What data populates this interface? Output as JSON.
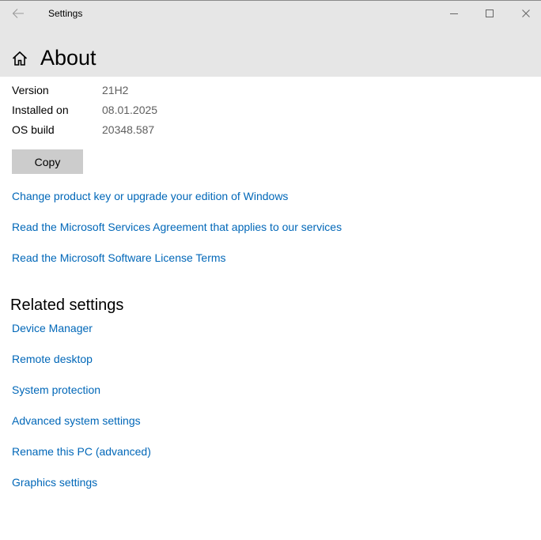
{
  "window": {
    "app_title": "Settings"
  },
  "header": {
    "page_title": "About"
  },
  "specs": [
    {
      "label": "Version",
      "value": "21H2"
    },
    {
      "label": "Installed on",
      "value": "08.01.2025"
    },
    {
      "label": "OS build",
      "value": "20348.587"
    }
  ],
  "copy_button": {
    "label": "Copy"
  },
  "links": [
    "Change product key or upgrade your edition of Windows",
    "Read the Microsoft Services Agreement that applies to our services",
    "Read the Microsoft Software License Terms"
  ],
  "related": {
    "title": "Related settings",
    "items": [
      "Device Manager",
      "Remote desktop",
      "System protection",
      "Advanced system settings",
      "Rename this PC (advanced)",
      "Graphics settings"
    ]
  },
  "colors": {
    "link": "#0067b8",
    "titlebar": "#e6e6e6",
    "button": "#cccccc",
    "secondary_text": "#5f5f5f"
  },
  "icons": {
    "back": "back-arrow-icon",
    "home": "home-icon",
    "minimize": "minimize-icon",
    "maximize": "maximize-icon",
    "close": "close-icon"
  }
}
